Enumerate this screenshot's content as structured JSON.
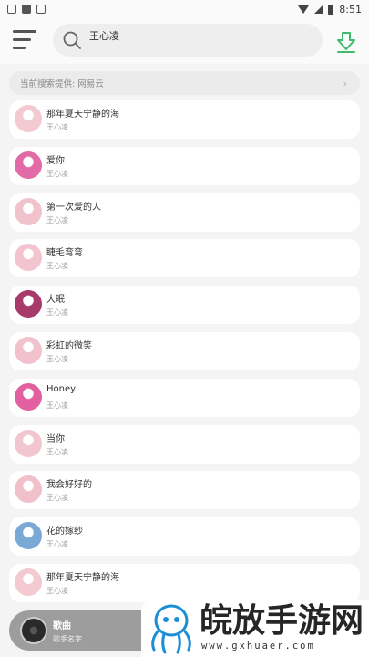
{
  "status_bar": {
    "time": "8:51"
  },
  "search": {
    "query": "王心凌"
  },
  "source_bar": {
    "text": "当前搜索提供: 网易云",
    "chevron": "›"
  },
  "songs": [
    {
      "title": "那年夏天宁静的海",
      "artist": "王心凌",
      "cover_color": "#f3c9d2"
    },
    {
      "title": "爱你",
      "artist": "王心凌",
      "cover_color": "#e26aa6"
    },
    {
      "title": "第一次爱的人",
      "artist": "王心凌",
      "cover_color": "#f0c3cc"
    },
    {
      "title": "睫毛弯弯",
      "artist": "王心凌",
      "cover_color": "#f2c4cf"
    },
    {
      "title": "大眠",
      "artist": "王心凌",
      "cover_color": "#a83a6a"
    },
    {
      "title": "彩虹的微笑",
      "artist": "王心凌",
      "cover_color": "#f1c2cd"
    },
    {
      "title": "Honey",
      "artist": "王心凌",
      "cover_color": "#e25fa0"
    },
    {
      "title": "当你",
      "artist": "王心凌",
      "cover_color": "#f2c6d0"
    },
    {
      "title": "我会好好的",
      "artist": "王心凌",
      "cover_color": "#f0c0cb"
    },
    {
      "title": "花的嫁纱",
      "artist": "王心凌",
      "cover_color": "#7aa9d6"
    },
    {
      "title": "那年夏天宁静的海",
      "artist": "王心凌",
      "cover_color": "#f3c9d2"
    }
  ],
  "player": {
    "title": "歌曲",
    "artist": "歌手名字"
  },
  "watermark": {
    "title": "皖放手游网",
    "url": "www.gxhuaer.com"
  },
  "colors": {
    "accent_green": "#3dbb6c",
    "background": "#f4f4f4",
    "card": "#ffffff"
  },
  "icons": {
    "menu": "menu-icon",
    "search": "search-icon",
    "download": "download-icon"
  }
}
